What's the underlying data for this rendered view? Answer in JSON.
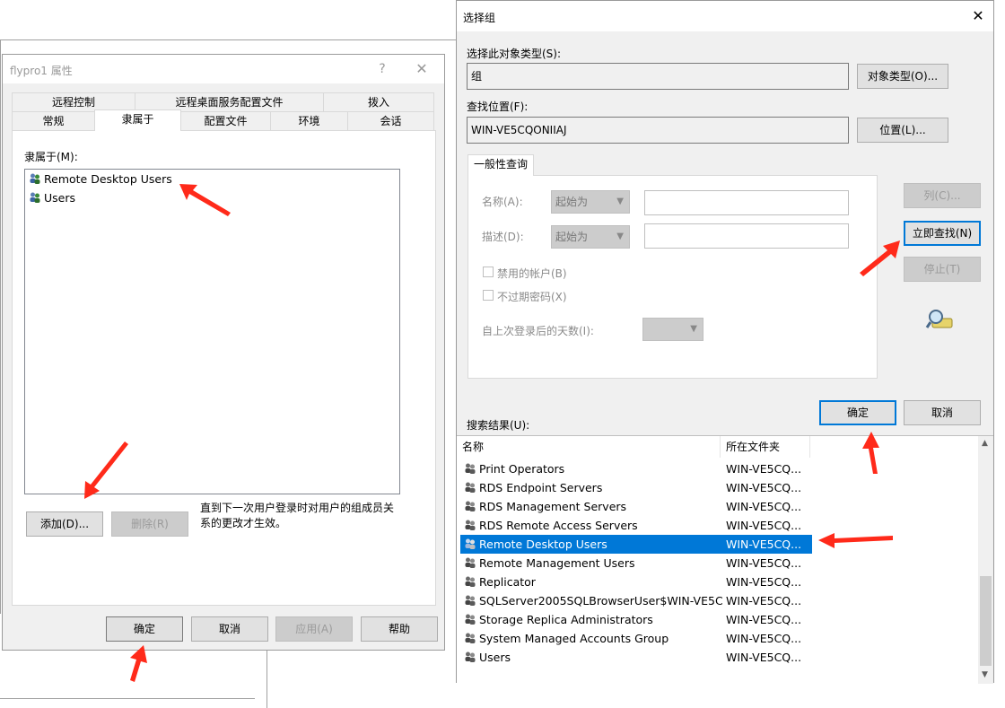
{
  "properties_dialog": {
    "title": "flypro1 属性",
    "help_glyph": "?",
    "close_glyph": "✕",
    "tabs_row1": [
      "远程控制",
      "远程桌面服务配置文件",
      "拨入"
    ],
    "tabs_row2": [
      "常规",
      "隶属于",
      "配置文件",
      "环境",
      "会话"
    ],
    "member_of_label": "隶属于(M):",
    "members": [
      "Remote Desktop Users",
      "Users"
    ],
    "add_button": "添加(D)...",
    "remove_button": "删除(R)",
    "note": [
      "直到下一次用户登录时对用户的组成员关",
      "系的更改才生效。"
    ],
    "ok": "确定",
    "cancel": "取消",
    "apply": "应用(A)",
    "help": "帮助"
  },
  "select_dialog": {
    "title": "选择组",
    "close_glyph": "✕",
    "object_type_label": "选择此对象类型(S):",
    "object_type_value": "组",
    "object_type_button": "对象类型(O)...",
    "location_label": "查找位置(F):",
    "location_value": "WIN-VE5CQONIIAJ",
    "location_button": "位置(L)...",
    "query_tab": "一般性查询",
    "name_label": "名称(A):",
    "desc_label": "描述(D):",
    "starts_with": "起始为",
    "disabled_accounts": "禁用的帐户(B)",
    "no_expire": "不过期密码(X)",
    "days_label": "自上次登录后的天数(I):",
    "columns_button": "列(C)...",
    "find_now_button": "立即查找(N)",
    "stop_button": "停止(T)",
    "ok": "确定",
    "cancel": "取消",
    "results_label": "搜索结果(U):",
    "col_name": "名称",
    "col_folder": "所在文件夹",
    "results": [
      {
        "name": "Print Operators",
        "folder": "WIN-VE5CQ..."
      },
      {
        "name": "RDS Endpoint Servers",
        "folder": "WIN-VE5CQ..."
      },
      {
        "name": "RDS Management Servers",
        "folder": "WIN-VE5CQ..."
      },
      {
        "name": "RDS Remote Access Servers",
        "folder": "WIN-VE5CQ..."
      },
      {
        "name": "Remote Desktop Users",
        "folder": "WIN-VE5CQ..."
      },
      {
        "name": "Remote Management Users",
        "folder": "WIN-VE5CQ..."
      },
      {
        "name": "Replicator",
        "folder": "WIN-VE5CQ..."
      },
      {
        "name": "SQLServer2005SQLBrowserUser$WIN-VE5C...",
        "folder": "WIN-VE5CQ..."
      },
      {
        "name": "Storage Replica Administrators",
        "folder": "WIN-VE5CQ..."
      },
      {
        "name": "System Managed Accounts Group",
        "folder": "WIN-VE5CQ..."
      },
      {
        "name": "Users",
        "folder": "WIN-VE5CQ..."
      }
    ],
    "scroll_up": "▲",
    "scroll_down": "▼"
  },
  "colors": {
    "accent": "#0078d7",
    "arrow": "#ff2a1a",
    "dialog_bg": "#f0f0f0"
  }
}
